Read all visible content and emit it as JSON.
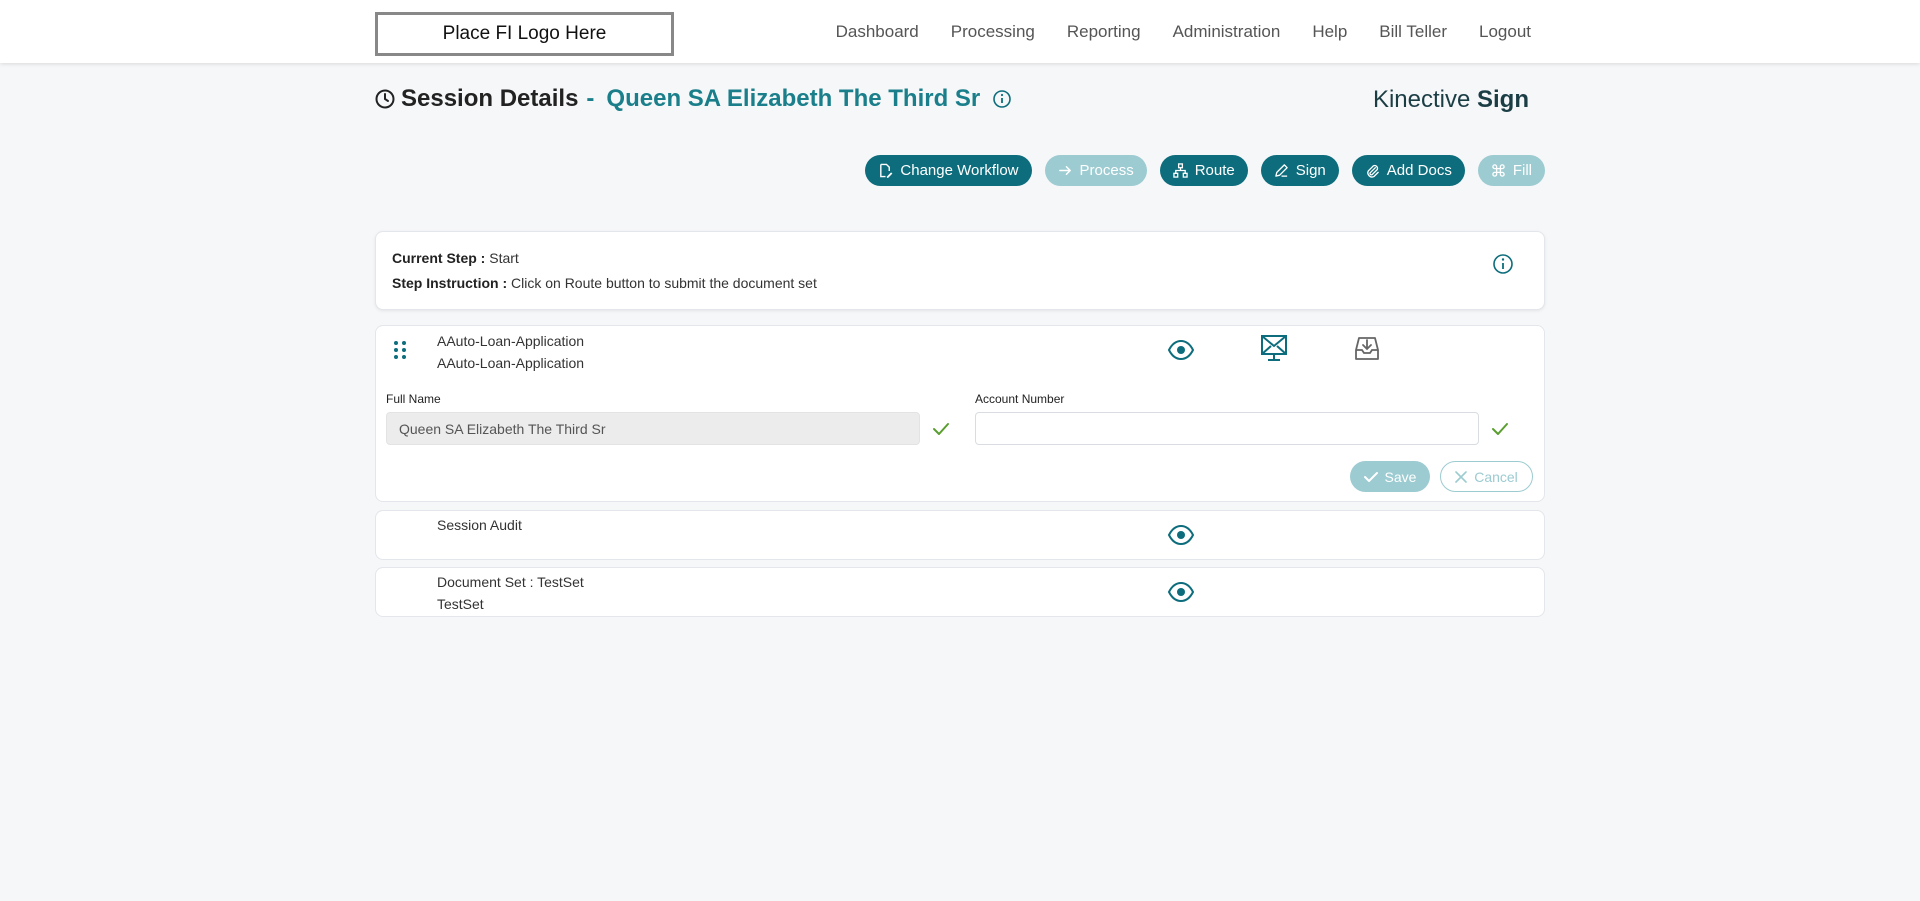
{
  "logo": "Place FI Logo Here",
  "nav": [
    "Dashboard",
    "Processing",
    "Reporting",
    "Administration",
    "Help",
    "Bill Teller",
    "Logout"
  ],
  "title": {
    "label": "Session Details",
    "separator": "-",
    "name": "Queen SA Elizabeth The Third Sr"
  },
  "brand": {
    "light": "Kinective",
    "bold": "Sign"
  },
  "actions": [
    {
      "label": "Change Workflow",
      "icon": "file-edit-icon",
      "enabled": true
    },
    {
      "label": "Process",
      "icon": "arrow-right-icon",
      "enabled": false
    },
    {
      "label": "Route",
      "icon": "sitemap-icon",
      "enabled": true
    },
    {
      "label": "Sign",
      "icon": "pen-icon",
      "enabled": true
    },
    {
      "label": "Add Docs",
      "icon": "paperclip-icon",
      "enabled": true
    },
    {
      "label": "Fill",
      "icon": "command-icon",
      "enabled": false
    }
  ],
  "step": {
    "current_label": "Current Step :",
    "current_value": "Start",
    "instruction_label": "Step Instruction :",
    "instruction_value": "Click on Route button to submit the document set"
  },
  "document": {
    "title": "AAuto-Loan-Application",
    "subtitle": "AAuto-Loan-Application",
    "fields": [
      {
        "label": "Full Name",
        "value": "Queen SA Elizabeth The Third Sr"
      },
      {
        "label": "Account Number",
        "value": ""
      }
    ],
    "save_label": "Save",
    "cancel_label": "Cancel"
  },
  "audit": {
    "title": "Session Audit"
  },
  "docset": {
    "title": "Document Set : TestSet",
    "subtitle": "TestSet"
  },
  "colors": {
    "accent": "#0d6d7c",
    "accent_disabled": "#9ccbd1",
    "check": "#5a9e2f"
  }
}
